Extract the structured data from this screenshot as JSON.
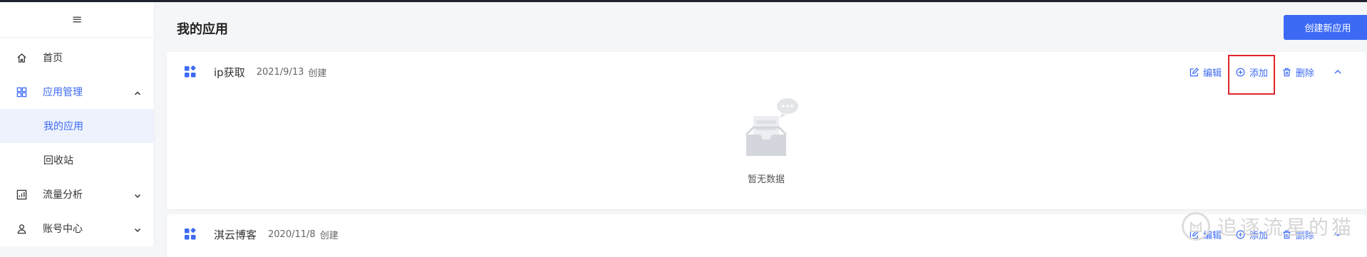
{
  "sidebar": {
    "toggle_icon": "≡",
    "items": [
      {
        "label": "首页",
        "icon": "home-icon"
      },
      {
        "label": "应用管理",
        "icon": "apps-icon",
        "expanded": true,
        "children": [
          {
            "label": "我的应用",
            "selected": true
          },
          {
            "label": "回收站"
          }
        ]
      },
      {
        "label": "流量分析",
        "icon": "chart-icon"
      },
      {
        "label": "账号中心",
        "icon": "user-icon"
      }
    ]
  },
  "main": {
    "title": "我的应用",
    "create_button": "创建新应用",
    "apps": [
      {
        "name": "ip获取",
        "date": "2021/9/13",
        "created_label": "创建",
        "expanded": true,
        "empty_text": "暂无数据"
      },
      {
        "name": "淇云博客",
        "date": "2020/11/8",
        "created_label": "创建",
        "expanded": false
      }
    ],
    "actions": {
      "edit": "编辑",
      "add": "添加",
      "delete": "删除"
    }
  },
  "watermark": {
    "text": "追逐流星的猫"
  },
  "colors": {
    "accent": "#3d6af5",
    "highlight_box": "#e0242b",
    "selected_bg": "#eef2fd"
  }
}
